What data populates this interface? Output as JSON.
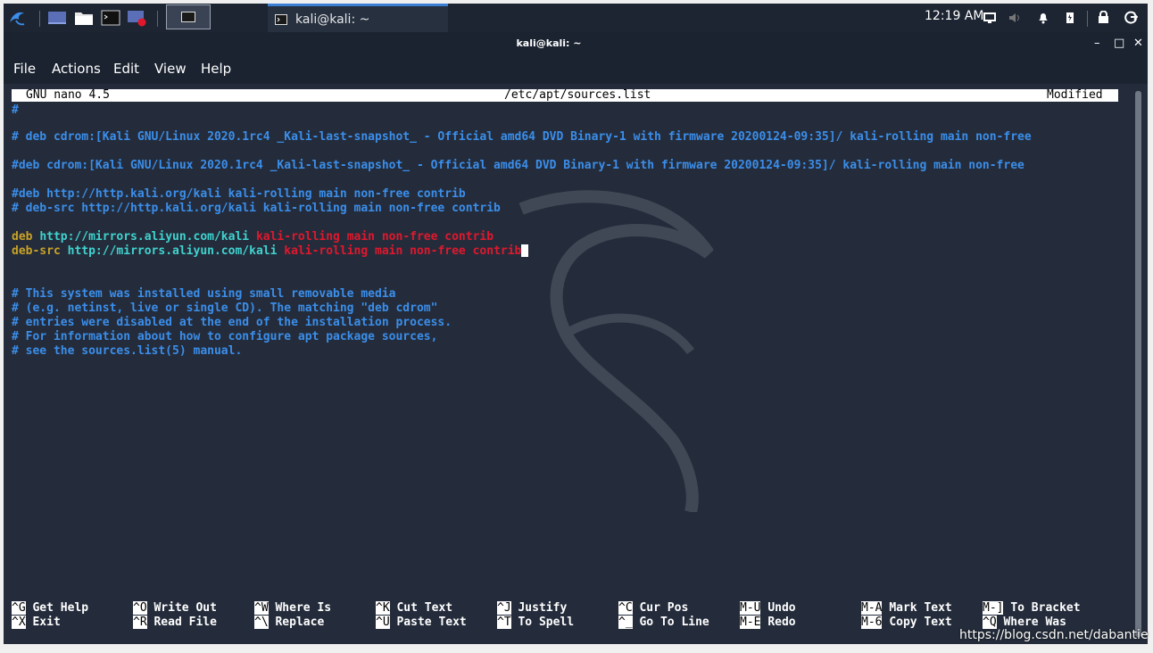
{
  "panel": {
    "task_label": "kali@kali: ~",
    "clock": "12:19 AM",
    "launchers": [
      "kali-menu-icon",
      "desktop-icon",
      "files-icon",
      "terminal-icon",
      "screen-recorder-icon"
    ]
  },
  "window": {
    "title": "kali@kali: ~",
    "controls": {
      "minimize": "–",
      "maximize": "□",
      "close": "✕"
    }
  },
  "menu": [
    "File",
    "Actions",
    "Edit",
    "View",
    "Help"
  ],
  "nano": {
    "version": "GNU nano 4.5",
    "filename": "/etc/apt/sources.list",
    "status": "Modified"
  },
  "file_lines": [
    "#",
    "# deb cdrom:[Kali GNU/Linux 2020.1rc4 _Kali-last-snapshot_ - Official amd64 DVD Binary-1 with firmware 20200124-09:35]/ kali-rolling main non-free",
    "#deb cdrom:[Kali GNU/Linux 2020.1rc4 _Kali-last-snapshot_ - Official amd64 DVD Binary-1 with firmware 20200124-09:35]/ kali-rolling main non-free",
    "#deb http://http.kali.org/kali kali-rolling main non-free contrib",
    "# deb-src http://http.kali.org/kali kali-rolling main non-free contrib",
    "# This system was installed using small removable media",
    "# (e.g. netinst, live or single CD). The matching \"deb cdrom\"",
    "# entries were disabled at the end of the installation process.",
    "# For information about how to configure apt package sources,",
    "# see the sources.list(5) manual."
  ],
  "deb_line": {
    "type": "deb",
    "url": "http://mirrors.aliyun.com/kali",
    "dist": "kali-rolling",
    "components": "main non-free contrib"
  },
  "debsrc_line": {
    "type": "deb-src",
    "url": "http://mirrors.aliyun.com/kali",
    "dist": "kali-rolling",
    "components": "main non-free contrib"
  },
  "shortcuts": [
    {
      "k1": "^G",
      "d1": "Get Help",
      "k2": "^X",
      "d2": "Exit"
    },
    {
      "k1": "^O",
      "d1": "Write Out",
      "k2": "^R",
      "d2": "Read File"
    },
    {
      "k1": "^W",
      "d1": "Where Is",
      "k2": "^\\",
      "d2": "Replace"
    },
    {
      "k1": "^K",
      "d1": "Cut Text",
      "k2": "^U",
      "d2": "Paste Text"
    },
    {
      "k1": "^J",
      "d1": "Justify",
      "k2": "^T",
      "d2": "To Spell"
    },
    {
      "k1": "^C",
      "d1": "Cur Pos",
      "k2": "^_",
      "d2": "Go To Line"
    },
    {
      "k1": "M-U",
      "d1": "Undo",
      "k2": "M-E",
      "d2": "Redo"
    },
    {
      "k1": "M-A",
      "d1": "Mark Text",
      "k2": "M-6",
      "d2": "Copy Text"
    },
    {
      "k1": "M-]",
      "d1": "To Bracket",
      "k2": "^Q",
      "d2": "Where Was"
    }
  ],
  "watermark": "https://blog.csdn.net/dabantie",
  "colors": {
    "comment": "#3b8eea",
    "keyword": "#c9a227",
    "url": "#40d3cf",
    "dist": "#e0182d",
    "terminal_bg": "#242c3b"
  }
}
